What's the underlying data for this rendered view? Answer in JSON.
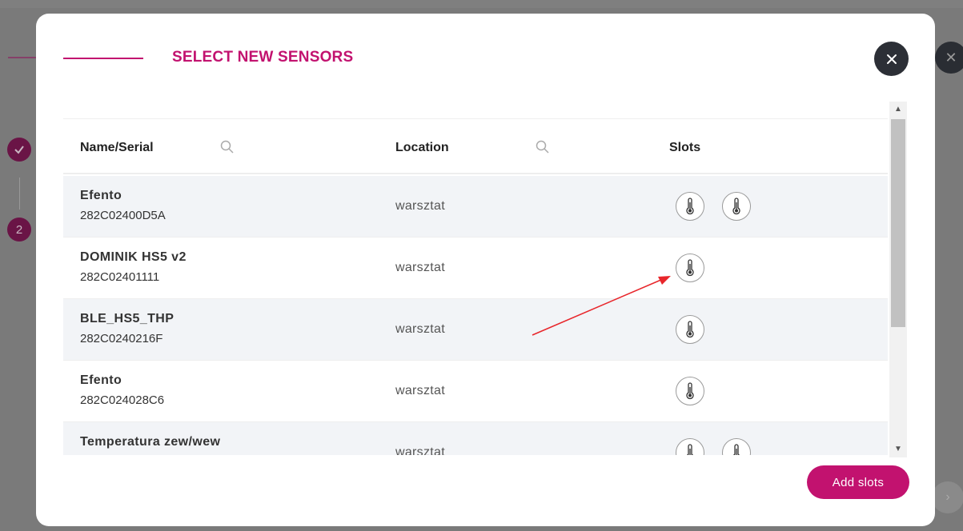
{
  "background": {
    "steps": [
      "",
      "2"
    ],
    "close_icon": "close-icon"
  },
  "modal": {
    "title": "SELECT NEW SENSORS",
    "close_icon": "close-icon"
  },
  "table": {
    "columns": {
      "name": "Name/Serial",
      "location": "Location",
      "slots": "Slots"
    },
    "rows": [
      {
        "name": "Efento",
        "serial": "282C02400D5A",
        "location": "warsztat",
        "slots": 2
      },
      {
        "name": "DOMINIK HS5 v2",
        "serial": "282C02401111",
        "location": "warsztat",
        "slots": 1
      },
      {
        "name": "BLE_HS5_THP",
        "serial": "282C0240216F",
        "location": "warsztat",
        "slots": 1
      },
      {
        "name": "Efento",
        "serial": "282C024028C6",
        "location": "warsztat",
        "slots": 1
      },
      {
        "name": "Temperatura zew/wew",
        "serial": "",
        "location": "warsztat",
        "slots": 2
      }
    ]
  },
  "actions": {
    "add_slots": "Add slots"
  },
  "colors": {
    "accent": "#c2126f",
    "annotation_arrow": "#e8262b"
  }
}
